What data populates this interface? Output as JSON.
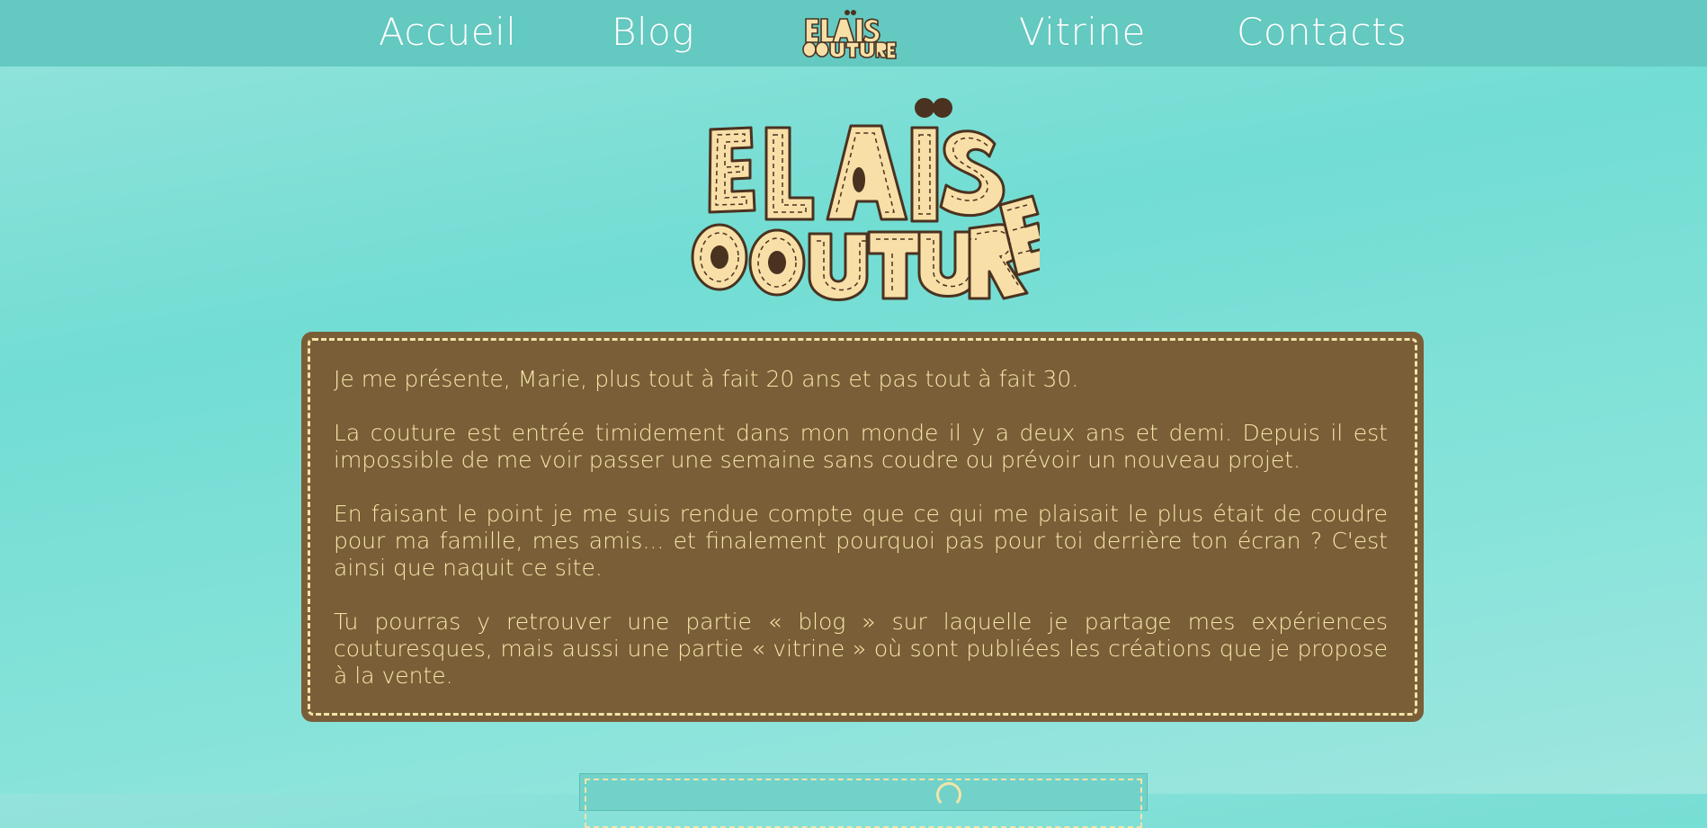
{
  "nav": {
    "items": [
      {
        "label": "Accueil"
      },
      {
        "label": "Blog"
      },
      {
        "label": "Vitrine"
      },
      {
        "label": "Contacts"
      }
    ],
    "logo_icon": "elais-couture-logo"
  },
  "hero": {
    "logo_icon": "elais-couture-logo"
  },
  "intro": {
    "paragraphs": [
      "Je me présente, Marie, plus tout à fait 20 ans et pas tout à fait 30.",
      "La couture est entrée timidement dans mon monde il y a deux ans et demi. Depuis il est impossible de me voir passer une semaine sans coudre ou prévoir un nouveau projet.",
      "En faisant le point je me suis rendue compte que ce qui me plaisait le plus était de coudre pour ma famille, mes amis... et finalement pourquoi pas pour toi derrière ton écran ? C'est ainsi que naquit ce site.",
      "Tu pourras y retrouver une partie « blog » sur laquelle je partage mes expériences couturesques, mais aussi une partie « vitrine » où sont publiées les créations que je propose à la vente."
    ]
  },
  "colors": {
    "nav_bg": "#64c9c0",
    "card_bg": "#7a5e38",
    "card_text": "#f6e7a8",
    "logo_fill": "#f8dfa7",
    "logo_outline": "#4a3220"
  }
}
